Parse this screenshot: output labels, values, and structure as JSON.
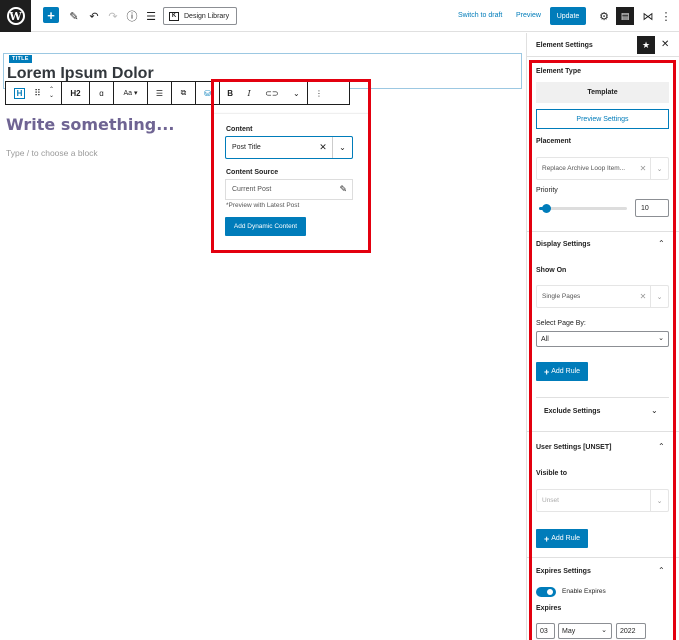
{
  "topbar": {
    "design_library": "Design Library",
    "switch_to_draft": "Switch to draft",
    "preview": "Preview",
    "update": "Update"
  },
  "editor": {
    "title_tag": "TITLE",
    "title_text": "Lorem Ipsum Dolor",
    "write_placeholder": "Write something...",
    "type_placeholder": "Type / to choose a block",
    "heading_level": "H2",
    "font_size_label": "Aa"
  },
  "popover": {
    "content_label": "Content",
    "content_value": "Post Title",
    "source_label": "Content Source",
    "source_value": "Current Post",
    "note": "*Preview with Latest Post",
    "add_button": "Add Dynamic Content"
  },
  "sidebar": {
    "title": "Element Settings",
    "element_type_label": "Element Type",
    "template_button": "Template",
    "preview_settings": "Preview Settings",
    "placement_label": "Placement",
    "placement_value": "Replace Archive Loop Item...",
    "priority_label": "Priority",
    "priority_value": "10",
    "priority_slider_fraction": 0.08,
    "display_settings": "Display Settings",
    "show_on_label": "Show On",
    "show_on_value": "Single Pages",
    "select_page_by_label": "Select Page By:",
    "select_page_by_value": "All",
    "add_rule": "Add Rule",
    "exclude_settings": "Exclude Settings",
    "user_settings": "User Settings [UNSET]",
    "visible_to_label": "Visible to",
    "visible_to_value": "Unset",
    "add_rule_2": "Add Rule",
    "expires_settings": "Expires Settings",
    "enable_expires": "Enable Expires",
    "expires_label": "Expires",
    "expires_day": "03",
    "expires_month": "May",
    "expires_year": "2022"
  },
  "colors": {
    "accent": "#007cba",
    "highlight_box": "#e3000f"
  }
}
